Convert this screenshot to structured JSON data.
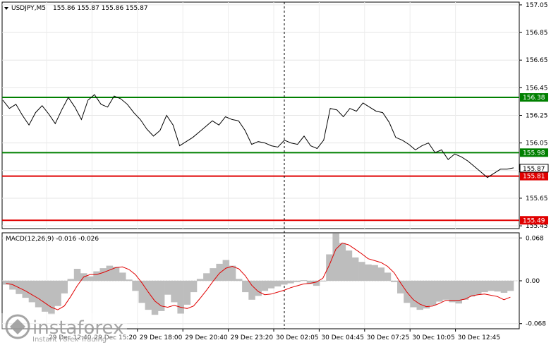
{
  "header": {
    "symbol": "USDJPY,M5",
    "ohlc": "155.86 155.87 155.86 155.87"
  },
  "macd": {
    "label": "MACD(12,26,9) -0.016 -0.026",
    "ticks": [
      "0.068",
      "0.00",
      "-0.068"
    ]
  },
  "watermark": {
    "brand": "instaforex",
    "tagline": "Instant Forex Trading"
  },
  "x_labels": [
    "29 Dec 12:40",
    "29 Dec 15:20",
    "29 Dec 18:00",
    "29 Dec 20:40",
    "29 Dec 23:20",
    "30 Dec 02:05",
    "30 Dec 04:45",
    "30 Dec 07:25",
    "30 Dec 10:05",
    "30 Dec 12:45"
  ],
  "colors": {
    "support": "#e00000",
    "resistance": "#008000",
    "price_line": "#000000",
    "macd_hist": "#bdbdbd",
    "macd_signal": "#e00000"
  },
  "chart_data": [
    {
      "type": "line",
      "title": "USDJPY,M5",
      "y_ticks": [
        157.05,
        156.85,
        156.65,
        156.45,
        156.25,
        156.05,
        155.85,
        155.65,
        155.45
      ],
      "ylim": [
        155.43,
        157.07
      ],
      "current_price": 155.87,
      "levels": [
        {
          "value": 156.38,
          "label": "156.38",
          "color": "green"
        },
        {
          "value": 155.98,
          "label": "155.98",
          "color": "green"
        },
        {
          "value": 155.81,
          "label": "155.81",
          "color": "red"
        },
        {
          "value": 155.49,
          "label": "155.49",
          "color": "red"
        }
      ],
      "x": [
        "29 Dec 12:40",
        "29 Dec 15:20",
        "29 Dec 18:00",
        "29 Dec 20:40",
        "29 Dec 23:20",
        "30 Dec 02:05",
        "30 Dec 04:45",
        "30 Dec 07:25",
        "30 Dec 10:05",
        "30 Dec 12:45"
      ],
      "price": [
        156.36,
        156.3,
        156.33,
        156.25,
        156.18,
        156.27,
        156.32,
        156.26,
        156.19,
        156.29,
        156.38,
        156.31,
        156.22,
        156.36,
        156.4,
        156.33,
        156.31,
        156.39,
        156.37,
        156.33,
        156.27,
        156.22,
        156.15,
        156.1,
        156.14,
        156.25,
        156.18,
        156.03,
        156.06,
        156.09,
        156.13,
        156.17,
        156.21,
        156.18,
        156.24,
        156.22,
        156.21,
        156.14,
        156.04,
        156.06,
        156.05,
        156.03,
        156.02,
        156.07,
        156.05,
        156.04,
        156.1,
        156.03,
        156.01,
        156.07,
        156.3,
        156.29,
        156.24,
        156.3,
        156.28,
        156.34,
        156.31,
        156.28,
        156.27,
        156.2,
        156.09,
        156.07,
        156.04,
        156.0,
        156.03,
        156.05,
        155.98,
        156.0,
        155.93,
        155.97,
        155.95,
        155.92,
        155.88,
        155.84,
        155.8,
        155.83,
        155.86,
        155.86,
        155.87
      ]
    },
    {
      "type": "bar",
      "title": "MACD(12,26,9)",
      "ylim": [
        -0.075,
        0.075
      ],
      "y_ticks": [
        0.068,
        0.0,
        -0.068
      ],
      "histogram": [
        -0.006,
        -0.014,
        -0.021,
        -0.027,
        -0.034,
        -0.042,
        -0.049,
        -0.053,
        -0.04,
        -0.02,
        0.003,
        0.019,
        0.012,
        0.007,
        0.015,
        0.02,
        0.024,
        0.022,
        0.013,
        0.002,
        -0.016,
        -0.035,
        -0.046,
        -0.054,
        -0.048,
        -0.022,
        -0.034,
        -0.052,
        -0.038,
        -0.018,
        0.003,
        0.012,
        0.02,
        0.027,
        0.033,
        0.024,
        0.003,
        -0.018,
        -0.03,
        -0.024,
        -0.016,
        -0.012,
        -0.009,
        -0.006,
        -0.004,
        -0.002,
        0.001,
        -0.005,
        -0.008,
        -0.001,
        0.042,
        0.075,
        0.06,
        0.048,
        0.037,
        0.03,
        0.026,
        0.025,
        0.021,
        0.013,
        -0.002,
        -0.02,
        -0.035,
        -0.042,
        -0.046,
        -0.044,
        -0.039,
        -0.033,
        -0.03,
        -0.034,
        -0.036,
        -0.03,
        -0.025,
        -0.022,
        -0.018,
        -0.016,
        -0.017,
        -0.019,
        -0.016
      ],
      "signal": [
        -0.004,
        -0.006,
        -0.011,
        -0.016,
        -0.022,
        -0.028,
        -0.035,
        -0.042,
        -0.046,
        -0.04,
        -0.025,
        -0.008,
        0.006,
        0.01,
        0.01,
        0.013,
        0.017,
        0.021,
        0.022,
        0.018,
        0.01,
        -0.003,
        -0.018,
        -0.032,
        -0.04,
        -0.042,
        -0.039,
        -0.042,
        -0.044,
        -0.04,
        -0.028,
        -0.015,
        -0.001,
        0.012,
        0.02,
        0.023,
        0.019,
        0.008,
        -0.007,
        -0.017,
        -0.022,
        -0.021,
        -0.018,
        -0.015,
        -0.011,
        -0.008,
        -0.005,
        -0.004,
        -0.002,
        0.004,
        0.025,
        0.05,
        0.06,
        0.057,
        0.05,
        0.043,
        0.035,
        0.032,
        0.029,
        0.023,
        0.013,
        -0.003,
        -0.018,
        -0.03,
        -0.037,
        -0.041,
        -0.04,
        -0.036,
        -0.031,
        -0.031,
        -0.031,
        -0.029,
        -0.024,
        -0.022,
        -0.021,
        -0.023,
        -0.025,
        -0.03,
        -0.026
      ]
    }
  ]
}
